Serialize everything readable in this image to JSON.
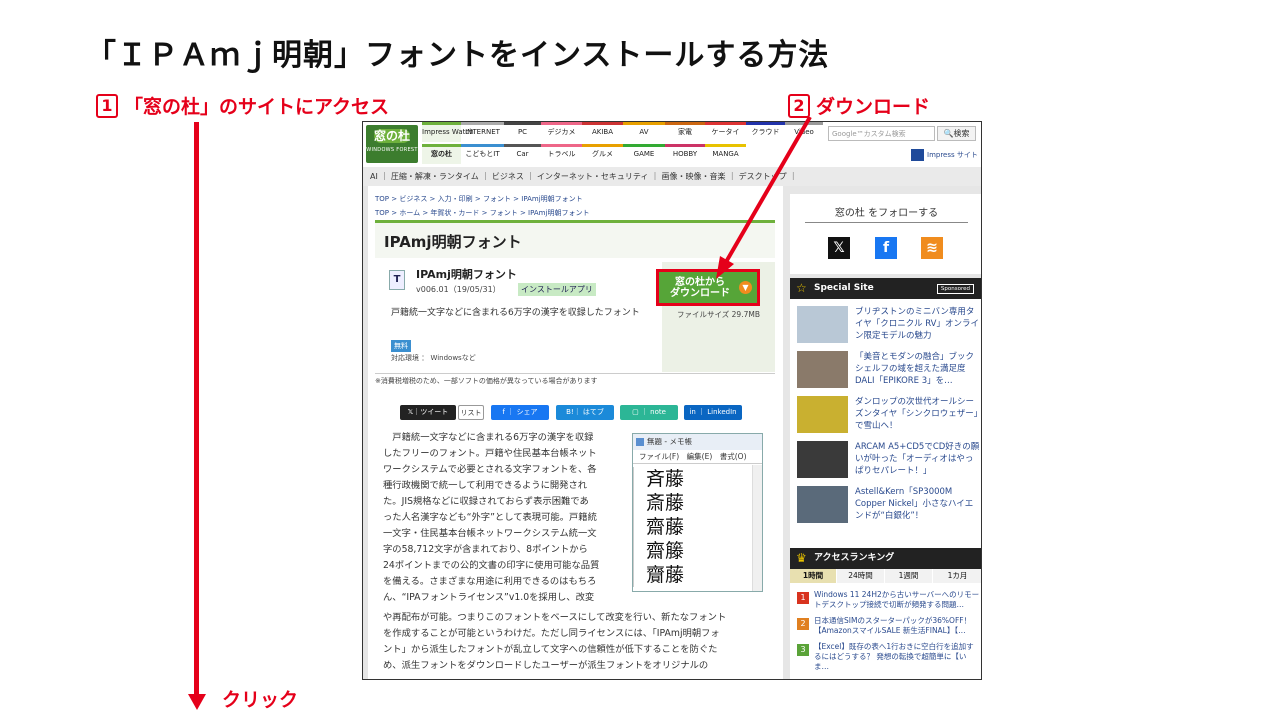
{
  "slide": {
    "title": "「ＩＰＡｍｊ明朝」フォントをインストールする方法",
    "step1": {
      "num": "1",
      "label": "「窓の杜」のサイトにアクセス"
    },
    "step2": {
      "num": "2",
      "label": "ダウンロード"
    },
    "click_label": "クリック",
    "accent": "#e5001a"
  },
  "site": {
    "logo": {
      "line1": "窓の杜",
      "line2": "WINDOWS FOREST"
    },
    "nav_top": [
      "Impress Watch",
      "INTERNET",
      "PC",
      "デジカメ",
      "AKIBA",
      "AV",
      "家電",
      "ケータイ",
      "クラウド",
      "Video"
    ],
    "nav_bottom": [
      "窓の杜",
      "こどもとIT",
      "Car",
      "トラベル",
      "グルメ",
      "GAME",
      "HOBBY",
      "MANGA"
    ],
    "search_placeholder": "Google™カスタム検索",
    "search_button": "検索",
    "impress_site": "Impress サイト",
    "subnav": "AI ｜ 圧縮・解凍・ランタイム ｜ ビジネス ｜ インターネット・セキュリティ ｜ 画像・映像・音楽 ｜ デスクトップ ｜",
    "breadcrumb1": "TOP > ビジネス > 入力・印刷 > フォント > IPAmj明朝フォント",
    "breadcrumb2": "TOP > ホーム > 年賀状・カード > フォント > IPAmj明朝フォント",
    "page_title": "IPAmj明朝フォント",
    "app": {
      "name": "IPAmj明朝フォント",
      "version": "v006.01（19/05/31）",
      "badge": "インストールアプリ",
      "description": "戸籍統一文字などに含まれる6万字の漢字を収録したフォント",
      "free": "無料",
      "os": "対応環境 ： Windowsなど",
      "download_line1": "窓の杜から",
      "download_line2": "ダウンロード",
      "file_size": "ファイルサイズ 29.7MB"
    },
    "tax_note": "※消費税増税のため、一部ソフトの価格が異なっている場合があります",
    "share": {
      "tweet": "ツイート",
      "list": "リスト",
      "facebook": "シェア",
      "hatena": "はてブ",
      "note": "note",
      "linkedin": "LinkedIn"
    },
    "article_lines": [
      "　戸籍統一文字などに含まれる6万字の漢字を収録",
      "したフリーのフォント。戸籍や住民基本台帳ネット",
      "ワークシステムで必要とされる文字フォントを、各",
      "種行政機関で統一して利用できるように開発され",
      "た。JIS規格などに収録されておらず表示困難であ",
      "った人名漢字なども“外字”として表現可能。戸籍統",
      "一文字・住民基本台帳ネットワークシステム統一文",
      "字の58,712文字が含まれており、8ポイントから",
      "24ポイントまでの公的文書の印字に使用可能な品質",
      "を備える。さまざまな用途に利用できるのはもちろ",
      "ん、“IPAフォントライセンス”v1.0を採用し、改変"
    ],
    "article_lines2": [
      "や再配布が可能。つまりこのフォントをベースにして改変を行い、新たなフォント",
      "を作成することが可能というわけだ。ただし同ライセンスには、「IPAmj明朝フォ",
      "ント」から派生したフォントが乱立して文字への信頼性が低下することを防ぐた",
      "め、派生フォントをダウンロードしたユーザーが派生フォントをオリジナルの"
    ],
    "notepad": {
      "title": "無題 - メモ帳",
      "menu": "ファイル(F)　編集(E)　書式(O)",
      "lines": [
        "斉藤",
        "斎藤",
        "齋藤",
        "齋籐",
        "齎藤"
      ]
    },
    "sidebar": {
      "follow_title": "窓の杜 をフォローする",
      "special_title": "Special Site",
      "sponsored": "Sponsored",
      "special_items": [
        "ブリヂストンのミニバン専用タイヤ「クロニクル RV」オンライン限定モデルの魅力",
        "「美音とモダンの融合」ブックシェルフの域を超えた満足度DALI「EPIKORE 3」を…",
        "ダンロップの次世代オールシーズンタイヤ「シンクロウェザー」で雪山へ！",
        "ARCAM A5+CD5でCD好きの願いが叶った「オーディオはやっぱりセパレート！」",
        "Astell&Kern「SP3000M Copper Nickel」小さなハイエンドが“白銀化”！"
      ],
      "ranking_title": "アクセスランキング",
      "ranking_tabs": [
        "1時間",
        "24時間",
        "1週間",
        "1カ月"
      ],
      "ranking_items": [
        {
          "num": "1",
          "text": "Windows 11 24H2から古いサーバーへのリモートデスクトップ接続で切断が頻発する問題…"
        },
        {
          "num": "2",
          "text": "日本通信SIMのスターターパックが36%OFF！【AmazonスマイルSALE 新生活FINAL】【…"
        },
        {
          "num": "3",
          "text": "【Excel】既存の表へ1行おきに空白行を追加するにはどうする？ 発想の転換で超簡単に【いま…"
        }
      ]
    }
  }
}
